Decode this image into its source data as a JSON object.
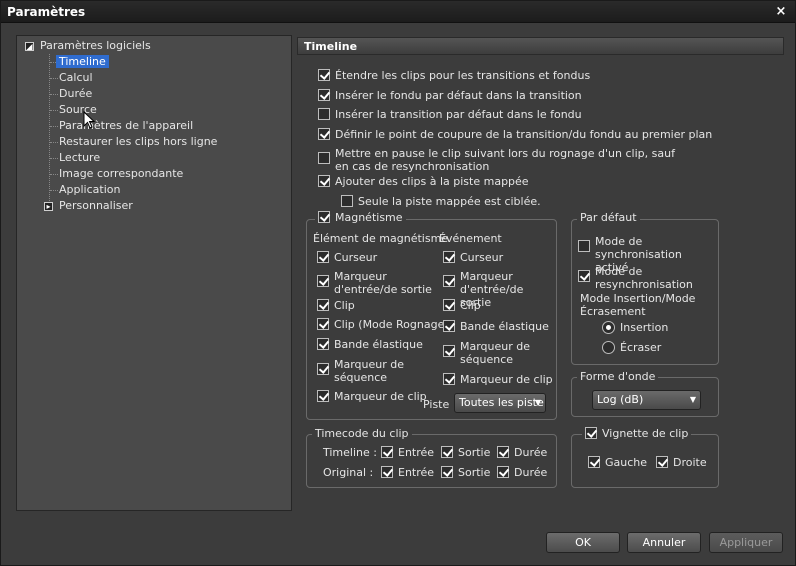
{
  "window": {
    "title": "Paramètres",
    "close": "×"
  },
  "tree": {
    "root": "Paramètres logiciels",
    "items": [
      "Timeline",
      "Calcul",
      "Durée",
      "Source",
      "Paramètres de l'appareil",
      "Restaurer les clips hors ligne",
      "Lecture",
      "Image correspondante",
      "Application"
    ],
    "root2": "Personnaliser",
    "expanded_glyph": "◢",
    "collapsed_glyph": "▸"
  },
  "panel": {
    "title": "Timeline"
  },
  "options": [
    {
      "label": "Étendre les clips pour les transitions et fondus",
      "checked": true
    },
    {
      "label": "Insérer le fondu par défaut dans la transition",
      "checked": true
    },
    {
      "label": "Insérer la transition par défaut dans le fondu",
      "checked": false
    },
    {
      "label": "Définir le point de coupure de la transition/du fondu au premier plan",
      "checked": true
    },
    {
      "label": "Mettre en pause le clip suivant lors du rognage d'un clip, sauf en cas de resynchronisation",
      "checked": false
    },
    {
      "label": "Ajouter des clips à la piste mappée",
      "checked": true
    },
    {
      "label": "Seule la piste mappée est ciblée.",
      "checked": false
    }
  ],
  "magnet": {
    "title": "Magnétisme",
    "checked": true,
    "col1_title": "Élément de magnétisme",
    "col2_title": "Événement",
    "col1": [
      {
        "label": "Curseur",
        "checked": true
      },
      {
        "label": "Marqueur d'entrée/de sortie",
        "checked": true
      },
      {
        "label": "Clip",
        "checked": true
      },
      {
        "label": "Clip (Mode Rognage)",
        "checked": true
      },
      {
        "label": "Bande élastique",
        "checked": true
      },
      {
        "label": "Marqueur de séquence",
        "checked": true
      },
      {
        "label": "Marqueur de clip",
        "checked": true
      }
    ],
    "col2": [
      {
        "label": "Curseur",
        "checked": true
      },
      {
        "label": "Marqueur d'entrée/de sortie",
        "checked": true
      },
      {
        "label": "Clip",
        "checked": true
      },
      {
        "label": "Bande élastique",
        "checked": true
      },
      {
        "label": "Marqueur de séquence",
        "checked": true
      },
      {
        "label": "Marqueur de clip",
        "checked": true
      }
    ],
    "track_label": "Piste",
    "track_value": "Toutes les piste"
  },
  "default": {
    "title": "Par défaut",
    "sync_active": {
      "label": "Mode de synchronisation activé",
      "checked": false
    },
    "resync": {
      "label": "Mode de resynchronisation",
      "checked": true
    },
    "mode_label": "Mode Insertion/Mode Écrasement",
    "insert": "Insertion",
    "overwrite": "Écraser"
  },
  "waveform": {
    "title": "Forme d'onde",
    "value": "Log (dB)"
  },
  "timecode": {
    "title": "Timecode du clip",
    "row1": "Timeline :",
    "row2": "Original :",
    "in": "Entrée",
    "out": "Sortie",
    "dur": "Durée"
  },
  "thumb": {
    "title": "Vignette de clip",
    "left": "Gauche",
    "right": "Droite"
  },
  "buttons": {
    "ok": "OK",
    "cancel": "Annuler",
    "apply": "Appliquer"
  }
}
